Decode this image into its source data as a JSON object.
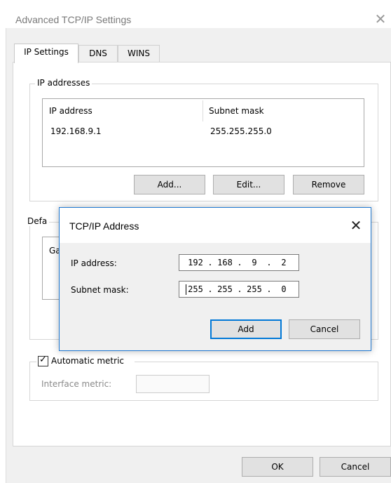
{
  "window": {
    "title": "Advanced TCP/IP Settings",
    "close_glyph": "✕"
  },
  "tabs": [
    {
      "label": "IP Settings"
    },
    {
      "label": "DNS"
    },
    {
      "label": "WINS"
    }
  ],
  "ip_group": {
    "title": "IP addresses",
    "columns": [
      "IP address",
      "Subnet mask"
    ],
    "rows": [
      {
        "ip": "192.168.9.1",
        "mask": "255.255.255.0"
      }
    ],
    "add_label": "Add...",
    "edit_label": "Edit...",
    "remove_label": "Remove"
  },
  "gateway_group": {
    "title_partial": "Defa",
    "column_partial": "Ga"
  },
  "metric": {
    "checkbox_label": "Automatic metric",
    "checked_glyph": "✓",
    "interface_label": "Interface metric:",
    "interface_value": ""
  },
  "footer": {
    "ok_label": "OK",
    "cancel_label": "Cancel"
  },
  "dialog": {
    "title": "TCP/IP Address",
    "close_glyph": "✕",
    "ip_label": "IP address:",
    "ip_octets": [
      "192",
      "168",
      "9",
      "2"
    ],
    "mask_label": "Subnet mask:",
    "mask_octets": [
      "255",
      "255",
      "255",
      "0"
    ],
    "dot": ".",
    "add_label": "Add",
    "cancel_label": "Cancel"
  },
  "colors": {
    "accent": "#0078d7",
    "window_bg": "#f0f0f0"
  }
}
